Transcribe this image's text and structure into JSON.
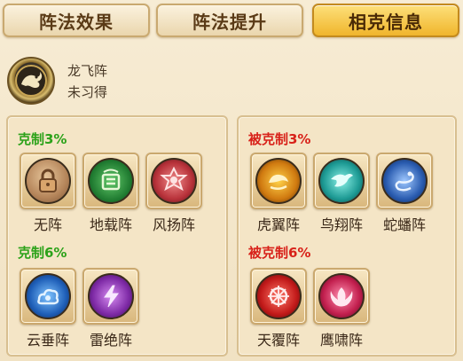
{
  "tabs": [
    {
      "label": "阵法效果",
      "active": false
    },
    {
      "label": "阵法提升",
      "active": false
    },
    {
      "label": "相克信息",
      "active": true
    }
  ],
  "formation": {
    "name": "龙飞阵",
    "status": "未习得",
    "icon": "dragon-formation-icon"
  },
  "left_panel": {
    "groups": [
      {
        "title": "克制3%",
        "color": "#2ca21a",
        "items": [
          {
            "label": "无阵",
            "icon": "lock-icon"
          },
          {
            "label": "地载阵",
            "icon": "earth-formation-icon"
          },
          {
            "label": "风扬阵",
            "icon": "wind-formation-icon"
          }
        ]
      },
      {
        "title": "克制6%",
        "color": "#2ca21a",
        "items": [
          {
            "label": "云垂阵",
            "icon": "cloud-formation-icon"
          },
          {
            "label": "雷绝阵",
            "icon": "thunder-formation-icon"
          }
        ]
      }
    ]
  },
  "right_panel": {
    "groups": [
      {
        "title": "被克制3%",
        "color": "#d8221a",
        "items": [
          {
            "label": "虎翼阵",
            "icon": "tiger-formation-icon"
          },
          {
            "label": "鸟翔阵",
            "icon": "bird-formation-icon"
          },
          {
            "label": "蛇蟠阵",
            "icon": "snake-formation-icon"
          }
        ]
      },
      {
        "title": "被克制6%",
        "color": "#d8221a",
        "items": [
          {
            "label": "天覆阵",
            "icon": "heaven-formation-icon"
          },
          {
            "label": "鹰啸阵",
            "icon": "eagle-formation-icon"
          }
        ]
      }
    ]
  }
}
